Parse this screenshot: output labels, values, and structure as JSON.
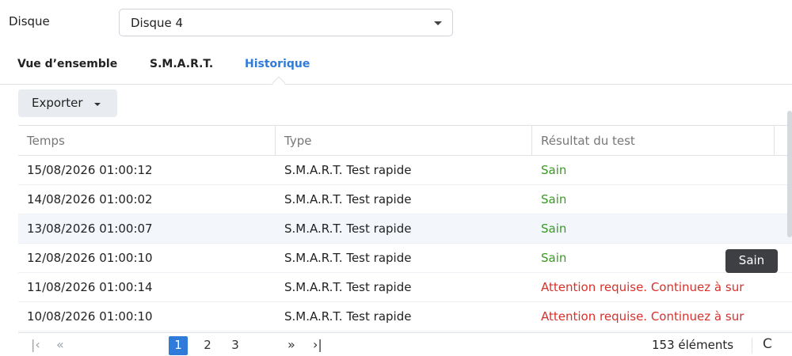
{
  "disk": {
    "label": "Disque",
    "selected": "Disque 4"
  },
  "tabs": [
    {
      "label": "Vue d’ensemble"
    },
    {
      "label": "S.M.A.R.T."
    },
    {
      "label": "Historique",
      "active": true
    }
  ],
  "toolbar": {
    "export_label": "Exporter"
  },
  "table": {
    "columns": [
      "Temps",
      "Type",
      "Résultat du test"
    ],
    "rows": [
      {
        "time": "15/08/2026 01:00:12",
        "type": "S.M.A.R.T. Test rapide",
        "result": "Sain",
        "status": "ok"
      },
      {
        "time": "14/08/2026 01:00:02",
        "type": "S.M.A.R.T. Test rapide",
        "result": "Sain",
        "status": "ok"
      },
      {
        "time": "13/08/2026 01:00:07",
        "type": "S.M.A.R.T. Test rapide",
        "result": "Sain",
        "status": "ok"
      },
      {
        "time": "12/08/2026 01:00:10",
        "type": "S.M.A.R.T. Test rapide",
        "result": "Sain",
        "status": "ok"
      },
      {
        "time": "11/08/2026 01:00:14",
        "type": "S.M.A.R.T. Test rapide",
        "result": "Attention requise. Continuez à sur",
        "status": "warn"
      },
      {
        "time": "10/08/2026 01:00:10",
        "type": "S.M.A.R.T. Test rapide",
        "result": "Attention requise. Continuez à sur",
        "status": "warn"
      }
    ]
  },
  "tooltip": {
    "text": "Sain"
  },
  "pagination": {
    "first_icon": "|‹",
    "prev_icon": "«",
    "pages": [
      "1",
      "2",
      "3"
    ],
    "current_page": "1",
    "next_icon": "»",
    "last_icon": "›|",
    "count_text": "153 éléments",
    "refresh_icon": "C"
  },
  "colors": {
    "accent": "#2f7bd9",
    "ok": "#3a9a24",
    "warn": "#d8312b",
    "selected_row": "#f3f7fc"
  },
  "icons": [
    "chevron-down-icon",
    "first-page-icon",
    "prev-page-icon",
    "next-page-icon",
    "last-page-icon",
    "refresh-icon"
  ]
}
